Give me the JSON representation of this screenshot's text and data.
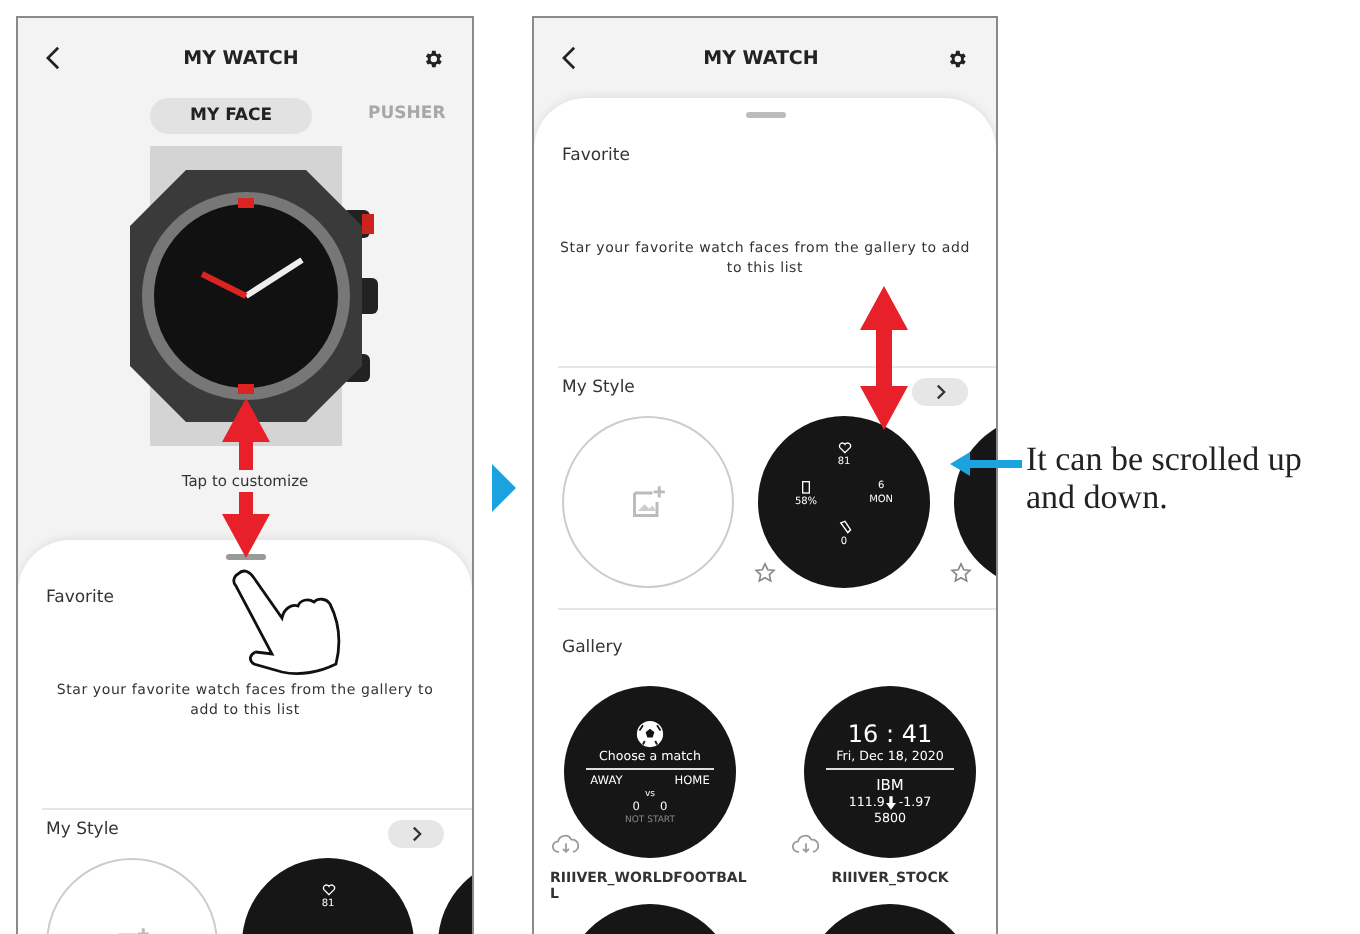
{
  "screens": [
    {
      "header": {
        "title": "MY WATCH"
      },
      "tabs": [
        {
          "label": "MY FACE",
          "selected": true
        },
        {
          "label": "PUSHER",
          "selected": false
        }
      ],
      "watch_caption": "Tap to customize",
      "sheet": {
        "expanded": false,
        "favorite": {
          "title": "Favorite",
          "message": "Star your favorite watch faces from the gallery to add to this list"
        },
        "my_style": {
          "title": "My Style",
          "faces": [
            {
              "kind": "add"
            },
            {
              "kind": "face",
              "heart": "81"
            },
            {
              "kind": "face"
            }
          ]
        }
      }
    },
    {
      "header": {
        "title": "MY WATCH"
      },
      "sheet": {
        "expanded": true,
        "favorite": {
          "title": "Favorite",
          "message": "Star your favorite watch faces from the gallery to add to this list"
        },
        "my_style": {
          "title": "My Style",
          "faces": [
            {
              "kind": "add"
            },
            {
              "kind": "face",
              "heart": "81",
              "battery": "58%",
              "day": "6",
              "weekday": "MON",
              "steps": "0",
              "starred": false
            },
            {
              "kind": "face",
              "starred": false
            }
          ]
        },
        "gallery": {
          "title": "Gallery",
          "items": [
            {
              "kind": "football",
              "title": "Choose a match",
              "away": "AWAY",
              "home": "HOME",
              "vs": "vs",
              "away_score": "0",
              "home_score": "0",
              "status": "NOT START",
              "name": "RIIIVER_WORLDFOOTBALL"
            },
            {
              "kind": "stock",
              "time": "16 : 41",
              "date": "Fri, Dec 18, 2020",
              "symbol": "IBM",
              "price": "111.9",
              "change": "-1.97",
              "volume": "5800",
              "name": "RIIIVER_STOCK"
            }
          ]
        }
      }
    }
  ],
  "note": "It can be scrolled up and down."
}
